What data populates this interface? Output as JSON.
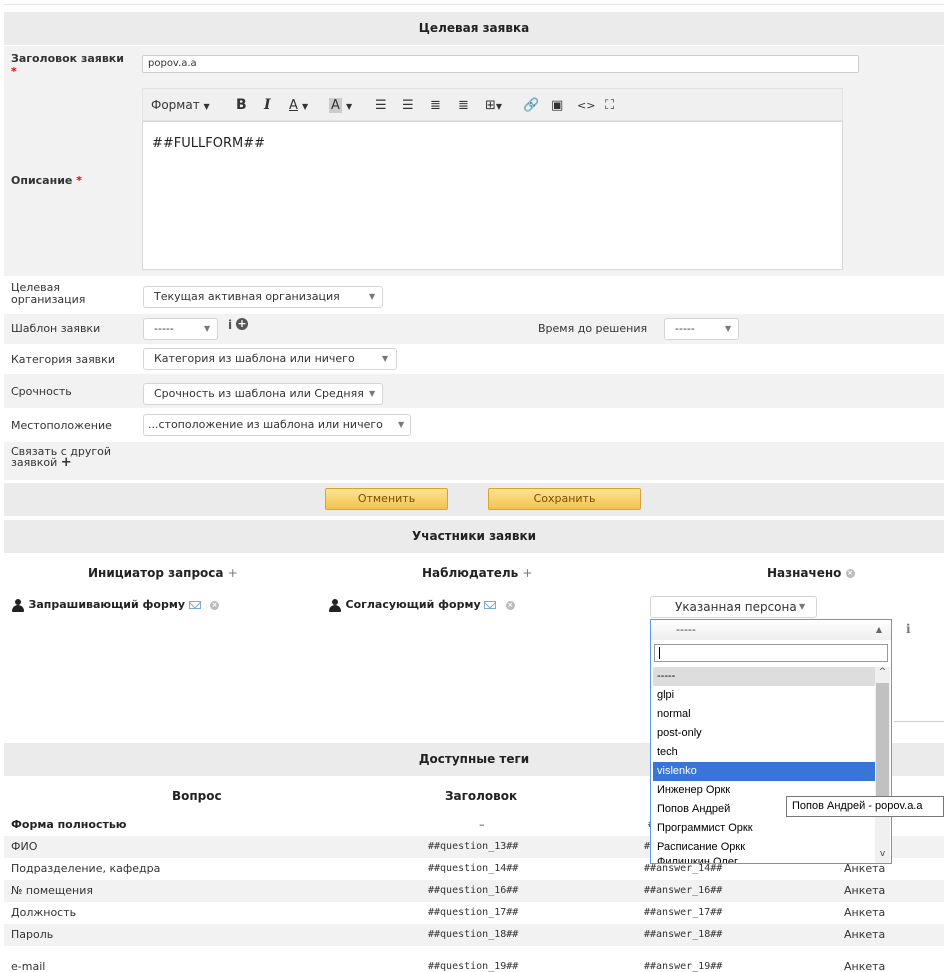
{
  "form": {
    "title": "Целевая заявка",
    "title_label": "Заголовок заявки",
    "title_value": "popov.a.a",
    "required_mark": "*",
    "description_label": "Описание",
    "editor_format": "Формат",
    "editor_content": "##FULLFORM##",
    "target_org_label": "Целевая организация",
    "target_org_value": "Текущая активная организация",
    "template_label": "Шаблон заявки",
    "template_value": "-----",
    "time_to_resolve_label": "Время до решения",
    "time_to_resolve_value": "-----",
    "category_label": "Категория заявки",
    "category_value": "Категория из шаблона или ничего",
    "urgency_label": "Срочность",
    "urgency_value": "Срочность из шаблона или Средняя",
    "location_label": "Местоположение",
    "location_value": "...стоположение из шаблона или ничего",
    "link_label": "Связать с другой заявкой",
    "cancel_label": "Отменить",
    "save_label": "Сохранить"
  },
  "actors": {
    "title": "Участники заявки",
    "requester_head": "Инициатор запроса",
    "observer_head": "Наблюдатель",
    "assigned_head": "Назначено",
    "requester_value": "Запрашивающий форму",
    "observer_value": "Согласующий форму",
    "assign_type_value": "Указанная персона",
    "person_select_value": "-----",
    "dropdown_items": [
      "-----",
      "glpi",
      "normal",
      "post-only",
      "tech",
      "vislenko",
      "Инженер Оркк",
      "Попов Андрей",
      "Программист Оркк",
      "Расписание Оркк",
      "Филишкин Олег"
    ],
    "tooltip": "Попов Андрей - popov.a.a"
  },
  "tags": {
    "title": "Доступные теги",
    "col_question": "Вопрос",
    "col_title": "Заголовок",
    "full_form_label": "Форма полностью",
    "full_form_title": "–",
    "full_form_answer": "###",
    "rows": [
      {
        "question": "ФИО",
        "title_tag": "##question_13##",
        "answer_tag": "##a",
        "section": ""
      },
      {
        "question": "Подразделение, кафедра",
        "title_tag": "##question_14##",
        "answer_tag": "##answer_14##",
        "section": "Анкета"
      },
      {
        "question": "№ помещения",
        "title_tag": "##question_16##",
        "answer_tag": "##answer_16##",
        "section": "Анкета"
      },
      {
        "question": "Должность",
        "title_tag": "##question_17##",
        "answer_tag": "##answer_17##",
        "section": "Анкета"
      },
      {
        "question": "Пароль",
        "title_tag": "##question_18##",
        "answer_tag": "##answer_18##",
        "section": "Анкета"
      },
      {
        "question": "e-mail",
        "title_tag": "##question_19##",
        "answer_tag": "##answer_19##",
        "section": "Анкета"
      }
    ]
  }
}
